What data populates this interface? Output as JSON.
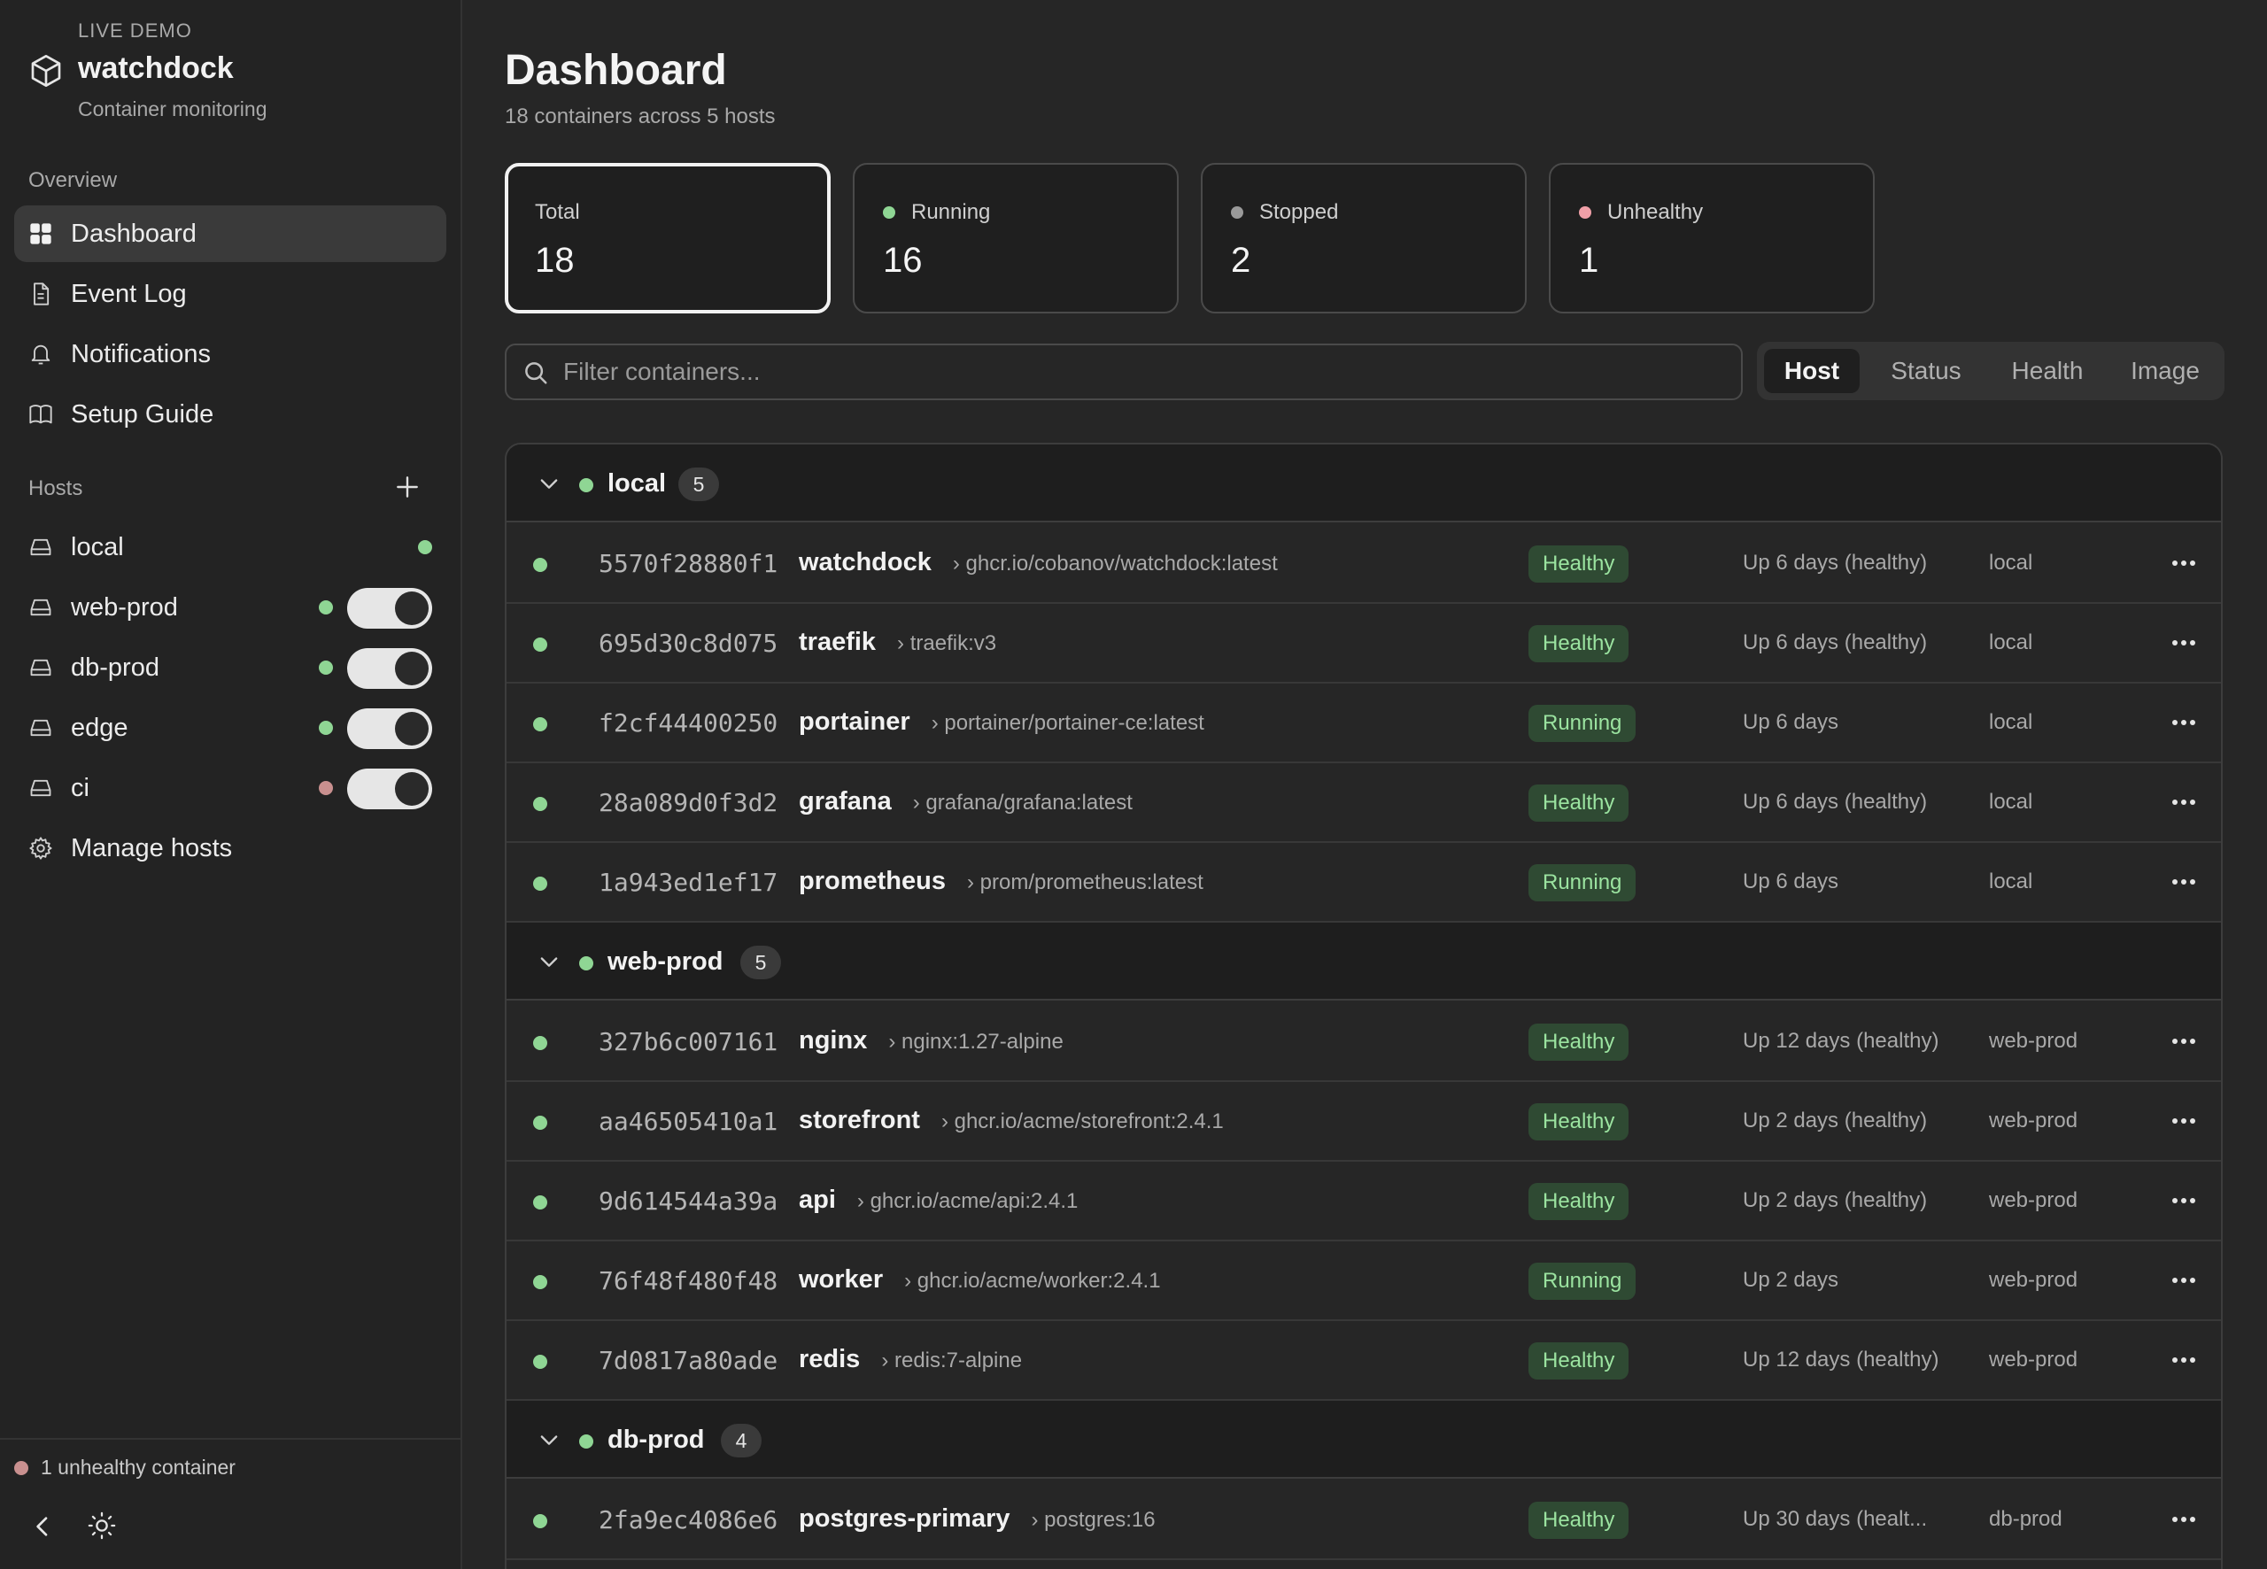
{
  "brand": {
    "demo_label": "LIVE DEMO",
    "name": "watchdock",
    "subtitle": "Container monitoring",
    "logo_icon": "cube-icon"
  },
  "sidebar": {
    "overview_label": "Overview",
    "nav": [
      {
        "label": "Dashboard",
        "icon": "grid-icon",
        "active": true
      },
      {
        "label": "Event Log",
        "icon": "document-icon",
        "active": false
      },
      {
        "label": "Notifications",
        "icon": "bell-icon",
        "active": false
      },
      {
        "label": "Setup Guide",
        "icon": "book-icon",
        "active": false
      }
    ],
    "hosts_label": "Hosts",
    "hosts": [
      {
        "name": "local",
        "status_color": "#8fd694",
        "toggle": false
      },
      {
        "name": "web-prod",
        "status_color": "#8fd694",
        "toggle": true,
        "enabled": true
      },
      {
        "name": "db-prod",
        "status_color": "#8fd694",
        "toggle": true,
        "enabled": true
      },
      {
        "name": "edge",
        "status_color": "#8fd694",
        "toggle": true,
        "enabled": true
      },
      {
        "name": "ci",
        "status_color": "#c9908f",
        "toggle": true,
        "enabled": true
      }
    ],
    "manage_hosts_label": "Manage hosts",
    "footer_status": "1 unhealthy container"
  },
  "header": {
    "title": "Dashboard",
    "subtitle": "18 containers across 5 hosts"
  },
  "stats": [
    {
      "label": "Total",
      "value": "18",
      "dot_color": null,
      "selected": true
    },
    {
      "label": "Running",
      "value": "16",
      "dot_color": "#8fd694",
      "selected": false
    },
    {
      "label": "Stopped",
      "value": "2",
      "dot_color": "#9a9a9a",
      "selected": false
    },
    {
      "label": "Unhealthy",
      "value": "1",
      "dot_color": "#f0a0a8",
      "selected": false
    }
  ],
  "search": {
    "placeholder": "Filter containers...",
    "value": ""
  },
  "group_by": {
    "options": [
      "Host",
      "Status",
      "Health",
      "Image"
    ],
    "selected": "Host"
  },
  "groups": [
    {
      "name": "local",
      "count": "5",
      "containers": [
        {
          "id": "5570f28880f1",
          "name": "watchdock",
          "image": "› ghcr.io/cobanov/watchdock:latest",
          "badge": "Healthy",
          "uptime": "Up 6 days (healthy)",
          "host": "local"
        },
        {
          "id": "695d30c8d075",
          "name": "traefik",
          "image": "› traefik:v3",
          "badge": "Healthy",
          "uptime": "Up 6 days (healthy)",
          "host": "local"
        },
        {
          "id": "f2cf44400250",
          "name": "portainer",
          "image": "› portainer/portainer-ce:latest",
          "badge": "Running",
          "uptime": "Up 6 days",
          "host": "local"
        },
        {
          "id": "28a089d0f3d2",
          "name": "grafana",
          "image": "› grafana/grafana:latest",
          "badge": "Healthy",
          "uptime": "Up 6 days (healthy)",
          "host": "local"
        },
        {
          "id": "1a943ed1ef17",
          "name": "prometheus",
          "image": "› prom/prometheus:latest",
          "badge": "Running",
          "uptime": "Up 6 days",
          "host": "local"
        }
      ]
    },
    {
      "name": "web-prod",
      "count": "5",
      "containers": [
        {
          "id": "327b6c007161",
          "name": "nginx",
          "image": "› nginx:1.27-alpine",
          "badge": "Healthy",
          "uptime": "Up 12 days (healthy)",
          "host": "web-prod"
        },
        {
          "id": "aa46505410a1",
          "name": "storefront",
          "image": "› ghcr.io/acme/storefront:2.4.1",
          "badge": "Healthy",
          "uptime": "Up 2 days (healthy)",
          "host": "web-prod"
        },
        {
          "id": "9d614544a39a",
          "name": "api",
          "image": "› ghcr.io/acme/api:2.4.1",
          "badge": "Healthy",
          "uptime": "Up 2 days (healthy)",
          "host": "web-prod"
        },
        {
          "id": "76f48f480f48",
          "name": "worker",
          "image": "› ghcr.io/acme/worker:2.4.1",
          "badge": "Running",
          "uptime": "Up 2 days",
          "host": "web-prod"
        },
        {
          "id": "7d0817a80ade",
          "name": "redis",
          "image": "› redis:7-alpine",
          "badge": "Healthy",
          "uptime": "Up 12 days (healthy)",
          "host": "web-prod"
        }
      ]
    },
    {
      "name": "db-prod",
      "count": "4",
      "containers": [
        {
          "id": "2fa9ec4086e6",
          "name": "postgres-primary",
          "image": "› postgres:16",
          "badge": "Healthy",
          "uptime": "Up 30 days (healt...",
          "host": "db-prod"
        }
      ]
    }
  ],
  "colors": {
    "status_ok": "#8fd694",
    "status_bad": "#c9908f",
    "badge_bg": "#2f4a33",
    "badge_fg": "#9be3a0"
  }
}
